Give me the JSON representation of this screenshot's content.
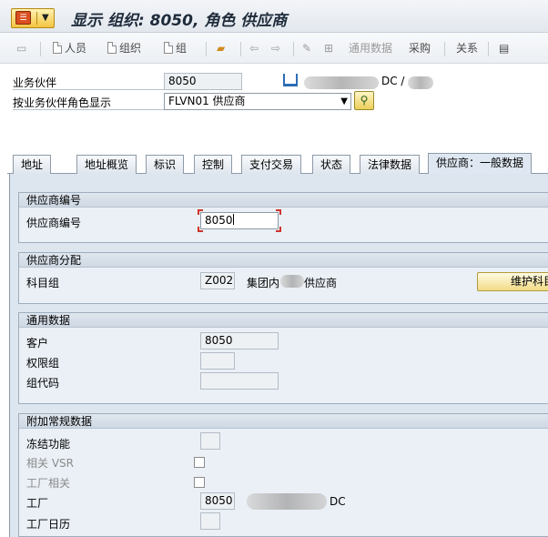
{
  "title": "显示 组织: 8050, 角色 供应商",
  "toolbar": {
    "person": "人员",
    "organization": "组织",
    "group": "组",
    "general_data": "通用数据",
    "purchasing": "采购",
    "relationships": "关系"
  },
  "header": {
    "bp_label": "业务伙伴",
    "bp_value": "8050",
    "bp_desc_suffix": "DC /",
    "role_label": "按业务伙伴角色显示",
    "role_value": "FLVN01 供应商"
  },
  "tabs": [
    "地址",
    "地址概览",
    "标识",
    "控制",
    "支付交易",
    "状态",
    "法律数据",
    "供应商：一般数据"
  ],
  "active_tab_index": 7,
  "groups": {
    "vendor_number": {
      "title": "供应商编号",
      "fields": {
        "vendor_number_label": "供应商编号",
        "vendor_number_value": "8050"
      }
    },
    "vendor_assignment": {
      "title": "供应商分配",
      "fields": {
        "account_group_label": "科目组",
        "account_group_value": "Z002",
        "account_group_desc_prefix": "集团内",
        "account_group_desc_suffix": "供应商",
        "maintain_button": "维护科目组"
      }
    },
    "general_data": {
      "title": "通用数据",
      "fields": {
        "customer_label": "客户",
        "customer_value": "8050",
        "auth_group_label": "权限组",
        "group_code_label": "组代码"
      }
    },
    "additional_data": {
      "title": "附加常规数据",
      "fields": {
        "block_function_label": "冻结功能",
        "vsr_label": "相关 VSR",
        "plant_related_label": "工厂相关",
        "plant_label": "工厂",
        "plant_value": "8050",
        "plant_desc_suffix": "DC",
        "factory_calendar_label": "工厂日历"
      }
    }
  },
  "colors": {
    "title_text": "#1e2b3a",
    "content_bg": "#dde6ef",
    "group_bg": "#eaf0f6",
    "focus_marker": "#d0342c",
    "button_yellow": "#f2dc86"
  }
}
